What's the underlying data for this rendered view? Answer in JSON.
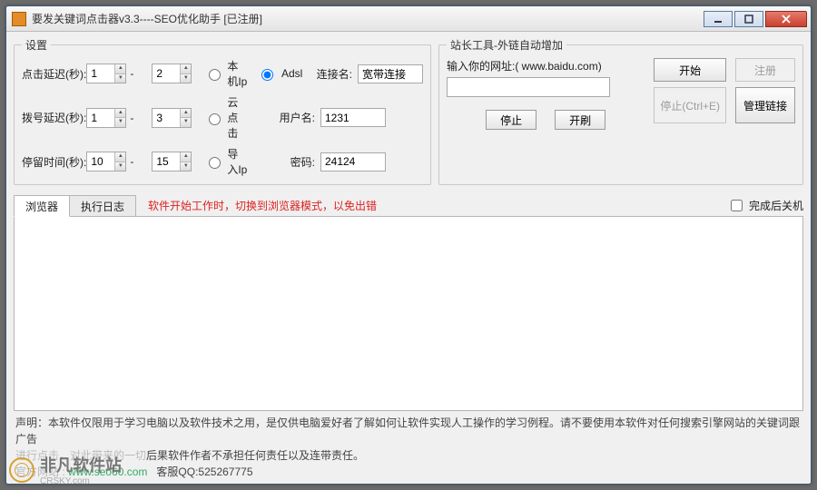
{
  "window": {
    "title": "要发关键词点击器v3.3----SEO优化助手   [已注册]"
  },
  "settings": {
    "legend": "设置",
    "click_delay_label": "点击延迟(秒):",
    "dial_delay_label": "拨号延迟(秒):",
    "stay_time_label": "停留时间(秒):",
    "click_delay_min": "1",
    "click_delay_max": "2",
    "dial_delay_min": "1",
    "dial_delay_max": "3",
    "stay_min": "10",
    "stay_max": "15",
    "radio_local": "本机Ip",
    "radio_adsl": "Adsl",
    "radio_cloud": "云点击",
    "radio_import": "导入Ip",
    "conn_label": "连接名:",
    "conn_value": "宽带连接",
    "user_label": "用户名:",
    "user_value": "1231",
    "pwd_label": "密码:",
    "pwd_value": "24124"
  },
  "tools": {
    "legend": "站长工具-外链自动增加",
    "url_label": "输入你的网址:( www.baidu.com)",
    "url_value": "",
    "start": "开始",
    "register": "注册",
    "stop_ctrl": "停止(Ctrl+E)",
    "manage_links": "管理链接",
    "stop": "停止",
    "refresh": "开刷"
  },
  "tabs": {
    "browser": "浏览器",
    "log": "执行日志",
    "hint": "软件开始工作时，切换到浏览器模式，以免出错",
    "shutdown_after": "完成后关机"
  },
  "footer": {
    "disclaimer": "声明：本软件仅限用于学习电脑以及软件技术之用，是仅供电脑爱好者了解如何让软件实现人工操作的学习例程。请不要使用本软件对任何搜索引擎网站的关键词跟广告",
    "disclaimer2_dim": "进行点击，对此带来的一切",
    "disclaimer2_rest": "后果软件作者不承担任何责任以及连带责任。",
    "site_label": "官方网站",
    "site_url": "www.seo60.com",
    "qq": "客服QQ:525267775"
  },
  "watermark": {
    "text": "非凡软件站",
    "sub": "CRSKY.com"
  }
}
